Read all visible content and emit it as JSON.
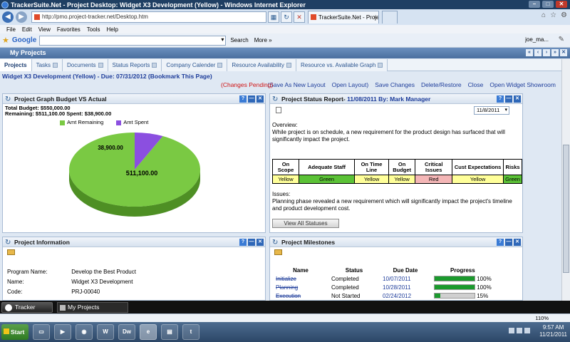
{
  "browser": {
    "title": "TrackerSuite.Net - Project Desktop: Widget X3 Development (Yellow) - Windows Internet Explorer",
    "url": "http://pmo.project-tracker.net/Desktop.htm",
    "tab_label": "TrackerSuite.Net - Project D...",
    "menu": [
      "File",
      "Edit",
      "View",
      "Favorites",
      "Tools",
      "Help"
    ],
    "google_label": "Google",
    "search_label": "Search",
    "more_label": "More »",
    "user_label": "joe_ma...",
    "zoom": "110%"
  },
  "app": {
    "header": "My Projects",
    "tabs": [
      {
        "label": "Projects",
        "active": true
      },
      {
        "label": "Tasks"
      },
      {
        "label": "Documents"
      },
      {
        "label": "Status Reports"
      },
      {
        "label": "Company Calender"
      },
      {
        "label": "Resource Availability"
      },
      {
        "label": "Resource vs. Available Graph"
      }
    ],
    "project_title": "Widget X3 Development (Yellow) - Due: 07/31/2012 (Bookmark This Page)",
    "changes_pending": "(Changes Pending)",
    "actions": [
      "(Save As New Layout",
      "Open Layout)",
      "Save Changes",
      "Delete/Restore",
      "Close",
      "Open Widget Showroom"
    ]
  },
  "budget_panel": {
    "title": "Project Graph Budget VS Actual",
    "total_budget": "Total Budget: $550,000.00",
    "remaining_spent": "Remaining: $511,100.00 Spent: $38,900.00",
    "legend_remaining": "Amt Remaining",
    "legend_spent": "Amt Spent",
    "label_remaining": "511,100.00",
    "label_spent": "38,900.00",
    "remaining_value": 511100,
    "spent_value": 38900,
    "colors": {
      "remaining": "#7ac943",
      "spent": "#8b4fe0"
    }
  },
  "status_panel": {
    "title": "Project Status Report-",
    "date_by": "11/08/2011 By: Mark Manager",
    "date_select": "11/8/2011",
    "overview_label": "Overview:",
    "overview_text": "While project is on schedule, a new requirement for the product design has surfaced that will significantly impact the project.",
    "table_headers": [
      "On Scope",
      "Adequate Staff",
      "On Time Line",
      "On Budget",
      "Critical Issues",
      "Cust Expectations",
      "Risks"
    ],
    "table_values": [
      "Yellow",
      "Green",
      "Yellow",
      "Yellow",
      "Red",
      "Yellow",
      "Green"
    ],
    "issues_label": "Issues:",
    "issues_text": "Planning phase revealed a new requirement which will significantly impact the project's timeline and product development cost.",
    "view_all": "View All Statuses"
  },
  "info_panel": {
    "title": "Project Information",
    "rows": [
      {
        "label": "Program Name:",
        "value": "Develop the Best Product"
      },
      {
        "label": "Name:",
        "value": "Widget X3 Development"
      },
      {
        "label": "Code:",
        "value": "PRJ-00040"
      }
    ]
  },
  "milestones_panel": {
    "title": "Project Milestones",
    "headers": [
      "Name",
      "Status",
      "Due Date",
      "Progress"
    ],
    "rows": [
      {
        "name": "Initialize",
        "status": "Completed",
        "due": "10/07/2011",
        "progress": 100,
        "progress_label": "100%"
      },
      {
        "name": "Planning",
        "status": "Completed",
        "due": "10/28/2011",
        "progress": 100,
        "progress_label": "100%"
      },
      {
        "name": "Execution",
        "status": "Not Started",
        "due": "02/24/2012",
        "progress": 15,
        "progress_label": "15%"
      }
    ]
  },
  "app_taskbar": {
    "tracker": "Tracker",
    "my_projects": "My Projects"
  },
  "windows_taskbar": {
    "start": "Start",
    "time": "9:57 AM",
    "date": "11/21/2011"
  }
}
